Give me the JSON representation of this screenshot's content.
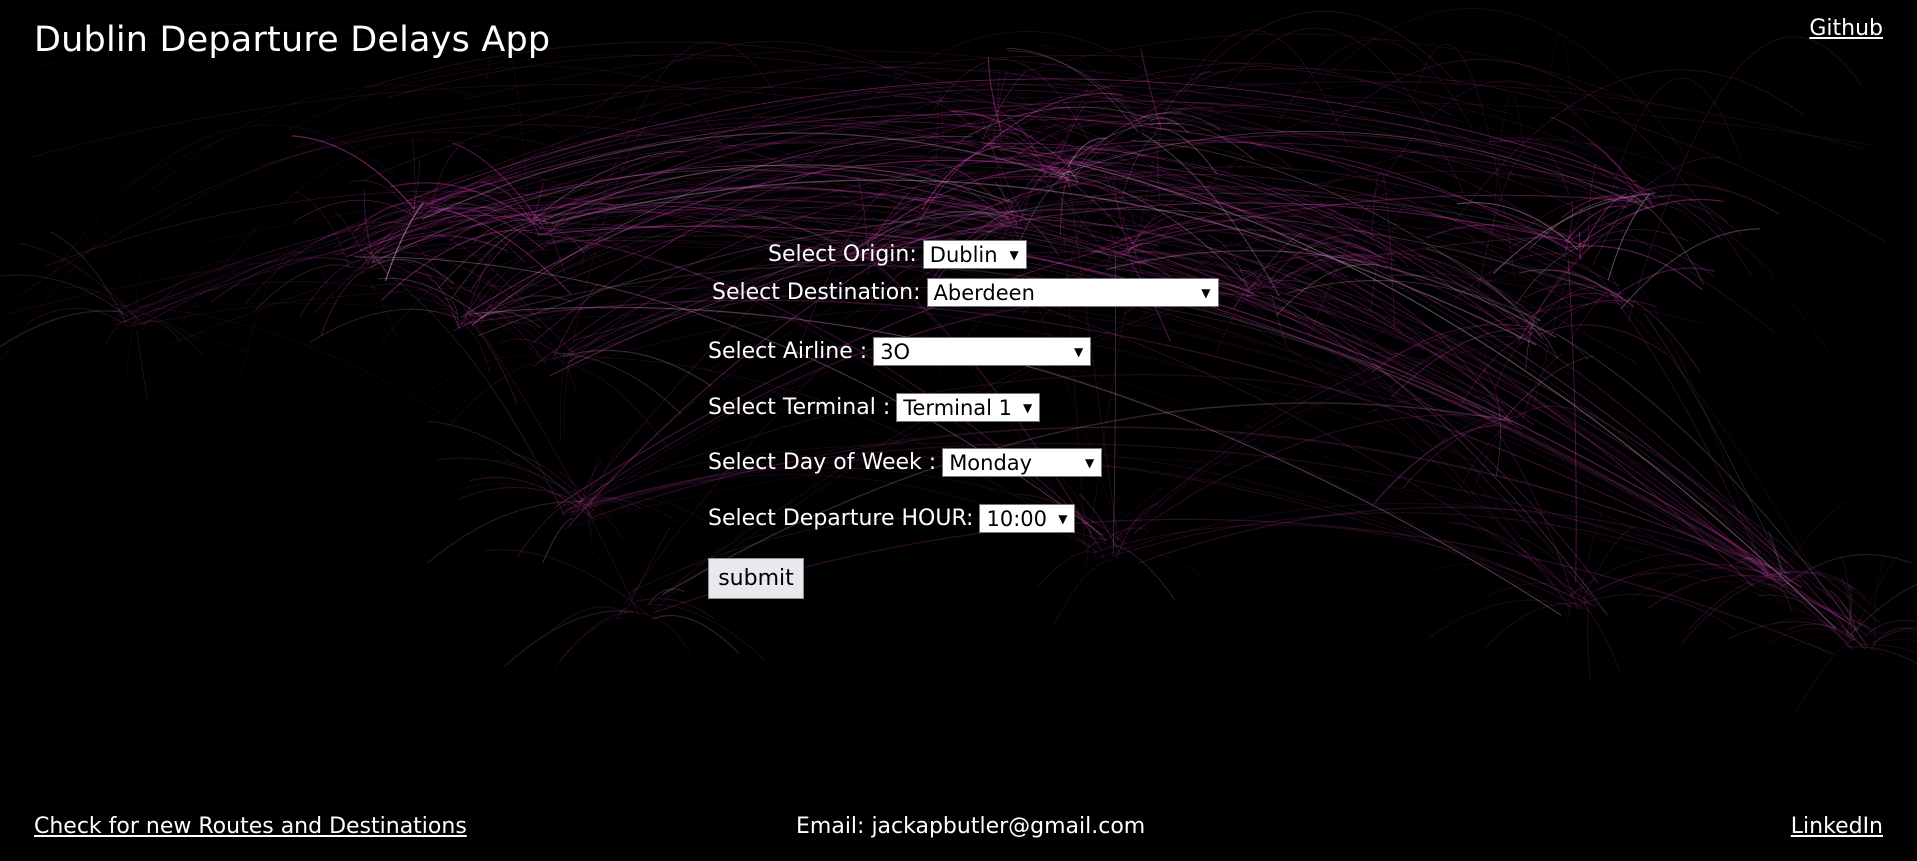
{
  "app": {
    "title": "Dublin Departure Delays App"
  },
  "header": {
    "github_label": "Github"
  },
  "form": {
    "origin": {
      "label": "Select Origin:",
      "value": "Dublin"
    },
    "destination": {
      "label": "Select Destination:",
      "value": "Aberdeen"
    },
    "airline": {
      "label": "Select Airline :",
      "value": "3O"
    },
    "terminal": {
      "label": "Select Terminal :",
      "value": "Terminal 1"
    },
    "day": {
      "label": "Select Day of Week :",
      "value": "Monday"
    },
    "hour": {
      "label": "Select Departure HOUR:",
      "value": "10:00"
    },
    "submit_label": "submit"
  },
  "footer": {
    "routes_link": "Check for new Routes and Destinations",
    "email": "Email: jackapbutler@gmail.com",
    "linkedin_label": "LinkedIn"
  },
  "theme": {
    "background": "#000000",
    "route_color": "#e040c0",
    "hub_color": "#ffc8f0"
  },
  "icons": {
    "dropdown": "dropdown-arrow-icon"
  }
}
